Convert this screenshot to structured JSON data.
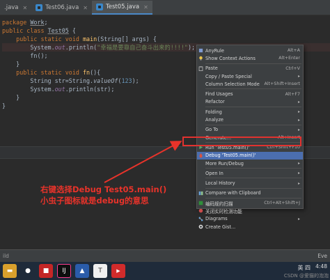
{
  "tabs": [
    {
      "label": ".java",
      "active": false
    },
    {
      "label": "Test06.java",
      "active": false
    },
    {
      "label": "Test05.java",
      "active": true
    }
  ],
  "code": {
    "l1_kw": "package",
    "l1_name": "Work",
    "l2_kw": "public class",
    "l2_name": "Test05",
    "l3_kw": "public static void",
    "l3_fn": "main",
    "l3_rest": "(String[] args) {",
    "l4_pre": "System.",
    "l4_field": "out",
    "l4_mid": ".println(",
    "l4_str": "\"幸福是要靠自己奋斗出来的!!!!\"",
    "l4_end": ");",
    "l5_call": "fn",
    "l5_end": "();",
    "l6": "}",
    "l7_kw": "public static void",
    "l7_fn": "fn",
    "l7_rest": "(){",
    "l8_pre": "String str=String.",
    "l8_static": "valueOf",
    "l8_open": "(",
    "l8_num": "123",
    "l8_end": ");",
    "l9_pre": "System.",
    "l9_field": "out",
    "l9_end": ".println(str);",
    "l10": "}",
    "l11": "}"
  },
  "menu": {
    "items": [
      {
        "label": "AnyRule",
        "shortcut": "Alt+A",
        "icon": "anyrule-icon"
      },
      {
        "label": "Show Context Actions",
        "shortcut": "Alt+Enter",
        "icon": "bulb-icon"
      },
      {
        "sep": true
      },
      {
        "label": "Paste",
        "shortcut": "Ctrl+V",
        "icon": "paste-icon"
      },
      {
        "label": "Copy / Paste Special",
        "arrow": true
      },
      {
        "label": "Column Selection Mode",
        "shortcut": "Alt+Shift+Insert"
      },
      {
        "sep": true
      },
      {
        "label": "Find Usages",
        "shortcut": "Alt+F7"
      },
      {
        "label": "Refactor",
        "arrow": true
      },
      {
        "sep": true
      },
      {
        "label": "Folding",
        "arrow": true
      },
      {
        "label": "Analyze",
        "arrow": true
      },
      {
        "sep": true
      },
      {
        "label": "Go To",
        "arrow": true
      },
      {
        "label": "Generate...",
        "shortcut": "Alt+Insert"
      },
      {
        "sep": true
      },
      {
        "label": "Run 'Test05.main()'",
        "shortcut": "Ctrl+Shift+F10",
        "icon": "run-icon"
      },
      {
        "label": "Debug 'Test05.main()'",
        "selected": true,
        "icon": "debug-icon"
      },
      {
        "label": "More Run/Debug",
        "arrow": true
      },
      {
        "sep": true
      },
      {
        "label": "Open In",
        "arrow": true
      },
      {
        "sep": true
      },
      {
        "label": "Local History",
        "arrow": true
      },
      {
        "sep": true
      },
      {
        "label": "Compare with Clipboard",
        "icon": "compare-icon"
      },
      {
        "sep": true
      },
      {
        "label": "编码规约扫描",
        "shortcut": "Ctrl+Alt+Shift+J",
        "icon": "scan-icon"
      },
      {
        "label": "关闭实时检测功能",
        "icon": "detect-off-icon"
      },
      {
        "label": "Diagrams",
        "arrow": true,
        "icon": "diagram-icon"
      },
      {
        "label": "Create Gist...",
        "icon": "github-icon"
      }
    ]
  },
  "annotation": {
    "line1": "右键选择Debug Test05.main()",
    "line2": "小虫子图标就是debug的意思"
  },
  "status": {
    "left": "ild",
    "right": "Eve"
  },
  "taskbar": {
    "ime": "英 四",
    "time": "4:48",
    "watermark": "CSDN @爱猫的泡泡"
  },
  "colors": {
    "keyword": "#cc7832",
    "string": "#6a8759",
    "number": "#6897bb",
    "field": "#9876aa",
    "method": "#ffc66d",
    "menu_selected": "#4b6eaf",
    "annotation": "#e8332a"
  }
}
